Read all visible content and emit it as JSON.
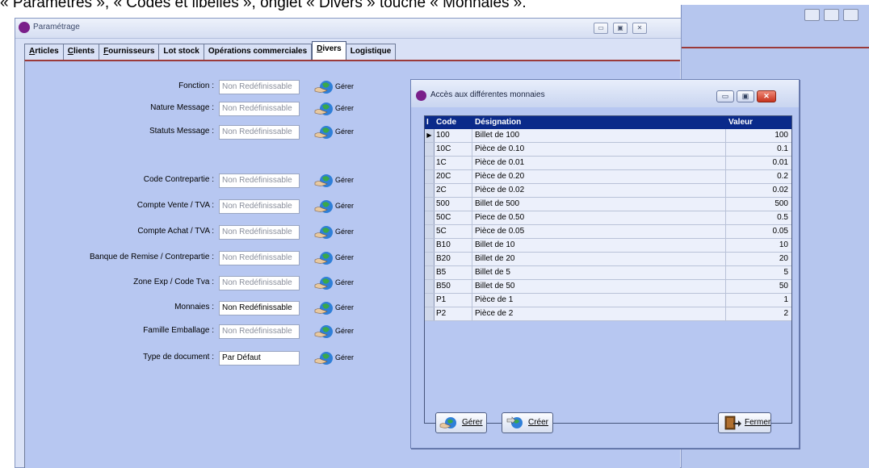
{
  "caption": "« Paramètres », « Codes et libellés », onglet « Divers » touche « Monnaies ».",
  "window": {
    "title": "Paramétrage",
    "btn_min": "▭",
    "btn_max": "▣",
    "btn_close": "✕"
  },
  "tabs": [
    {
      "u": "A",
      "rest": "rticles"
    },
    {
      "u": "C",
      "rest": "lients"
    },
    {
      "u": "F",
      "rest": "ournisseurs"
    },
    {
      "u": "",
      "rest": "Lot stock"
    },
    {
      "u": "",
      "rest": "Opérations commerciales"
    },
    {
      "u": "D",
      "rest": "ivers"
    },
    {
      "u": "",
      "rest": "Logistique"
    }
  ],
  "form": {
    "gerer_label": "Gérer",
    "fields": [
      {
        "label": "Fonction :",
        "value": "Non Redéfinissable"
      },
      {
        "label": "Nature Message :",
        "value": "Non Redéfinissable"
      },
      {
        "label": "Statuts Message :",
        "value": "Non Redéfinissable"
      },
      {
        "label": "Code Contrepartie :",
        "value": "Non Redéfinissable"
      },
      {
        "label": "Compte Vente / TVA :",
        "value": "Non Redéfinissable"
      },
      {
        "label": "Compte Achat / TVA :",
        "value": "Non Redéfinissable"
      },
      {
        "label": "Banque de Remise / Contrepartie :",
        "value": "Non Redéfinissable"
      },
      {
        "label": "Zone Exp / Code Tva :",
        "value": "Non Redéfinissable"
      },
      {
        "label": "Monnaies :",
        "value": "Non Redéfinissable"
      },
      {
        "label": "Famille Emballage :",
        "value": "Non Redéfinissable"
      },
      {
        "label": "Type de document :",
        "value": "Par Défaut"
      }
    ]
  },
  "dialog": {
    "title": "Accès aux différentes monnaies",
    "columns": [
      "Code",
      "Désignation",
      "Valeur"
    ],
    "rows": [
      [
        "100",
        "Billet de 100",
        "100"
      ],
      [
        "10C",
        "Pièce de 0.10",
        "0.1"
      ],
      [
        "1C",
        "Pièce de 0.01",
        "0.01"
      ],
      [
        "20C",
        "Pièce de 0.20",
        "0.2"
      ],
      [
        "2C",
        "Pièce de 0.02",
        "0.02"
      ],
      [
        "500",
        "Billet de 500",
        "500"
      ],
      [
        "50C",
        "Piece de 0.50",
        "0.5"
      ],
      [
        "5C",
        "Pièce de 0.05",
        "0.05"
      ],
      [
        "B10",
        "Billet de 10",
        "10"
      ],
      [
        "B20",
        "Billet de 20",
        "20"
      ],
      [
        "B5",
        "Billet de 5",
        "5"
      ],
      [
        "B50",
        "Billet de 50",
        "50"
      ],
      [
        "P1",
        "Pièce de 1",
        "1"
      ],
      [
        "P2",
        "Pièce de 2",
        "2"
      ]
    ],
    "buttons": {
      "gerer": "Gérer",
      "creer": "Créer",
      "fermer": "Fermer"
    }
  }
}
